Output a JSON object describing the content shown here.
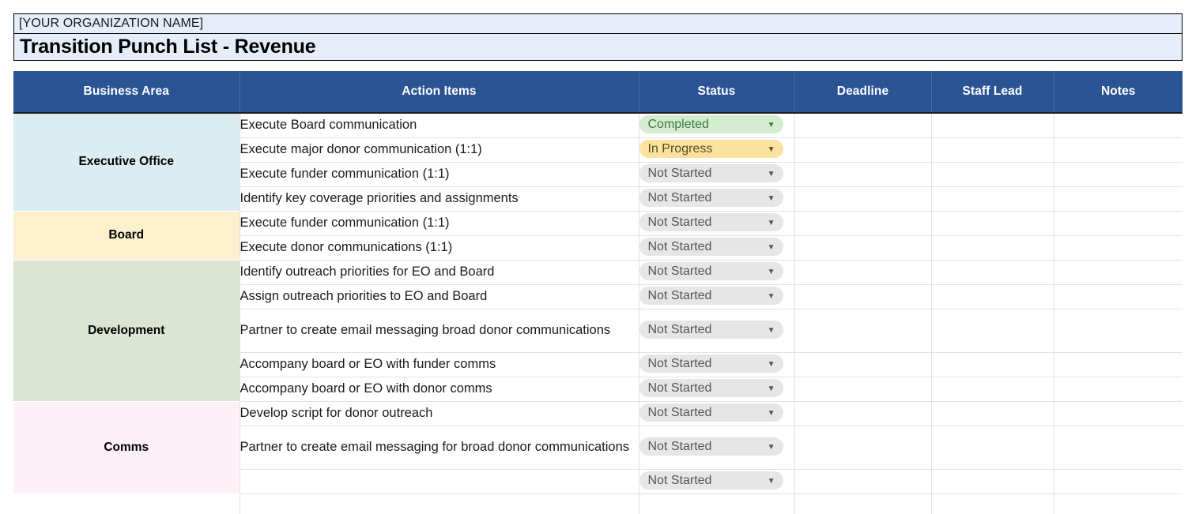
{
  "document": {
    "organization_placeholder": "[YOUR ORGANIZATION NAME]",
    "title": "Transition Punch List - Revenue"
  },
  "colors": {
    "header_blue": "#2b5494",
    "title_band": "#e6edf9",
    "executive_office": "#dcedf2",
    "board": "#fcf0cf",
    "development": "#dce5d2",
    "comms": "#fdf0f6",
    "status_completed_bg": "#d5ecd0",
    "status_inprogress_bg": "#fbe2a0",
    "status_notstarted_bg": "#e6e6e6"
  },
  "table": {
    "columns": [
      {
        "key": "business_area",
        "label": "Business Area"
      },
      {
        "key": "action_items",
        "label": "Action Items"
      },
      {
        "key": "status",
        "label": "Status"
      },
      {
        "key": "deadline",
        "label": "Deadline"
      },
      {
        "key": "staff_lead",
        "label": "Staff Lead"
      },
      {
        "key": "notes",
        "label": "Notes"
      }
    ],
    "caret_icon": "▼",
    "groups": [
      {
        "area": "Executive Office",
        "rows": [
          {
            "action": "Execute Board communication",
            "status": "Completed",
            "status_key": "completed",
            "deadline": "",
            "staff_lead": "",
            "notes": ""
          },
          {
            "action": "Execute major donor communication (1:1)",
            "status": "In Progress",
            "status_key": "inprogress",
            "deadline": "",
            "staff_lead": "",
            "notes": ""
          },
          {
            "action": "Execute funder communication (1:1)",
            "status": "Not Started",
            "status_key": "notstarted",
            "deadline": "",
            "staff_lead": "",
            "notes": ""
          },
          {
            "action": "Identify key coverage priorities and assignments",
            "status": "Not Started",
            "status_key": "notstarted",
            "deadline": "",
            "staff_lead": "",
            "notes": ""
          }
        ]
      },
      {
        "area": "Board",
        "rows": [
          {
            "action": "Execute funder communication (1:1)",
            "status": "Not Started",
            "status_key": "notstarted",
            "deadline": "",
            "staff_lead": "",
            "notes": ""
          },
          {
            "action": "Execute donor communications (1:1)",
            "status": "Not Started",
            "status_key": "notstarted",
            "deadline": "",
            "staff_lead": "",
            "notes": ""
          }
        ]
      },
      {
        "area": "Development",
        "rows": [
          {
            "action": "Identify outreach priorities for EO and Board",
            "status": "Not Started",
            "status_key": "notstarted",
            "deadline": "",
            "staff_lead": "",
            "notes": ""
          },
          {
            "action": "Assign outreach priorities to EO and Board",
            "status": "Not Started",
            "status_key": "notstarted",
            "deadline": "",
            "staff_lead": "",
            "notes": ""
          },
          {
            "action": "Partner to create email messaging broad donor communications",
            "status": "Not Started",
            "status_key": "notstarted",
            "deadline": "",
            "staff_lead": "",
            "notes": ""
          },
          {
            "action": "Accompany board or EO with funder comms",
            "status": "Not Started",
            "status_key": "notstarted",
            "deadline": "",
            "staff_lead": "",
            "notes": ""
          },
          {
            "action": "Accompany board or EO with donor comms",
            "status": "Not Started",
            "status_key": "notstarted",
            "deadline": "",
            "staff_lead": "",
            "notes": ""
          }
        ]
      },
      {
        "area": "Comms",
        "rows": [
          {
            "action": "Develop script for donor outreach",
            "status": "Not Started",
            "status_key": "notstarted",
            "deadline": "",
            "staff_lead": "",
            "notes": ""
          },
          {
            "action": "Partner to create email messaging for broad donor communications",
            "status": "Not Started",
            "status_key": "notstarted",
            "deadline": "",
            "staff_lead": "",
            "notes": ""
          },
          {
            "action": "",
            "status": "Not Started",
            "status_key": "notstarted",
            "deadline": "",
            "staff_lead": "",
            "notes": ""
          }
        ]
      }
    ]
  }
}
